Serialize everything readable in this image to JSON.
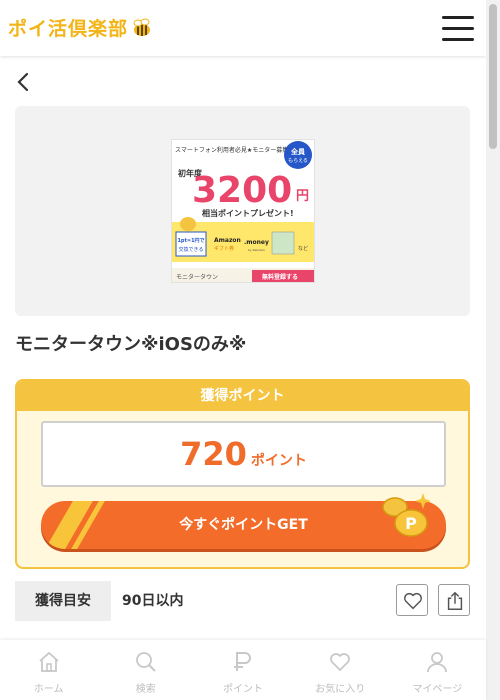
{
  "header": {
    "logo_text": "ポイ活倶楽部"
  },
  "banner": {
    "tagline": "スマートフォン利用者必見★モニター募集",
    "badge_line1": "全員",
    "badge_line2": "もらえる",
    "year_label": "初年度",
    "amount": "3200",
    "amount_unit": "円",
    "subtitle": "相当ポイントプレゼント!",
    "exchange_line1": "1pt=1円で",
    "exchange_line2": "交換できる",
    "amazon_line1": "Amazon",
    "amazon_line2": "ギフト券",
    "money_line1": ".money",
    "money_line2": "by Rakuten",
    "etc": "など",
    "brand": "モニタータウン",
    "cta": "無料登録する"
  },
  "offer": {
    "title": "モニタータウン※iOSのみ※",
    "point_heading": "獲得ポイント",
    "point_value": "720",
    "point_unit": "ポイント",
    "get_button": "今すぐポイントGET",
    "estimate_label": "獲得目安",
    "estimate_value": "90日以内"
  },
  "nav": [
    {
      "label": "ホーム",
      "icon": "home-icon"
    },
    {
      "label": "検索",
      "icon": "search-icon"
    },
    {
      "label": "ポイント",
      "icon": "point-icon"
    },
    {
      "label": "お気に入り",
      "icon": "heart-icon"
    },
    {
      "label": "マイページ",
      "icon": "user-icon"
    }
  ],
  "colors": {
    "accent_yellow": "#f4c33f",
    "accent_orange": "#f36c2a",
    "card_bg": "#fff8dc"
  }
}
